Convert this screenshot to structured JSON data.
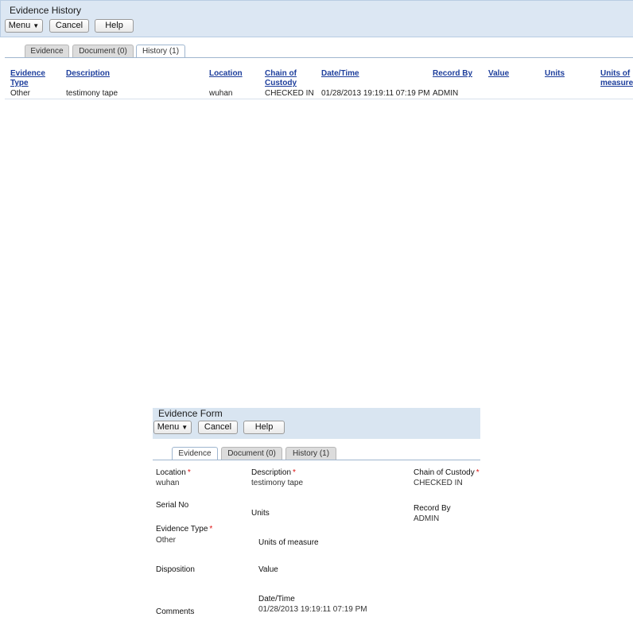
{
  "history_window": {
    "title": "Evidence History",
    "buttons": {
      "menu": "Menu",
      "cancel": "Cancel",
      "help": "Help"
    },
    "tabs": [
      "Evidence",
      "Document (0)",
      "History (1)"
    ],
    "active_tab": "History (1)",
    "table": {
      "headers": [
        "Evidence Type",
        "Description",
        "Location",
        "Chain of Custody",
        "Date/Time",
        "Record By",
        "Value",
        "Units",
        "Units of measure"
      ],
      "rows": [
        [
          "Other",
          "testimony tape",
          "wuhan",
          "CHECKED IN",
          "01/28/2013 19:19:11 07:19 PM",
          "ADMIN",
          "",
          "",
          ""
        ]
      ]
    }
  },
  "evidence_form": {
    "title": "Evidence Form",
    "buttons": {
      "menu": "Menu",
      "cancel": "Cancel",
      "help": "Help"
    },
    "tabs": [
      "Evidence",
      "Document (0)",
      "History (1)"
    ],
    "active_tab": "Evidence",
    "fields": {
      "location": {
        "label": "Location",
        "value": "wuhan",
        "required": true
      },
      "description": {
        "label": "Description",
        "value": "testimony tape",
        "required": true
      },
      "chain_of_custody": {
        "label": "Chain of Custody",
        "value": "CHECKED IN",
        "required": true
      },
      "serial_no": {
        "label": "Serial No",
        "value": ""
      },
      "units": {
        "label": "Units",
        "value": ""
      },
      "record_by": {
        "label": "Record By",
        "value": "ADMIN"
      },
      "evidence_type": {
        "label": "Evidence Type",
        "value": "Other",
        "required": true
      },
      "units_of_measure": {
        "label": "Units of measure",
        "value": ""
      },
      "disposition": {
        "label": "Disposition",
        "value": ""
      },
      "value": {
        "label": "Value",
        "value": ""
      },
      "date_time": {
        "label": "Date/Time",
        "value": "01/28/2013 19:19:11 07:19 PM"
      },
      "comments": {
        "label": "Comments",
        "value": ""
      }
    },
    "required_marker": "*",
    "menu_caret": "▼"
  }
}
